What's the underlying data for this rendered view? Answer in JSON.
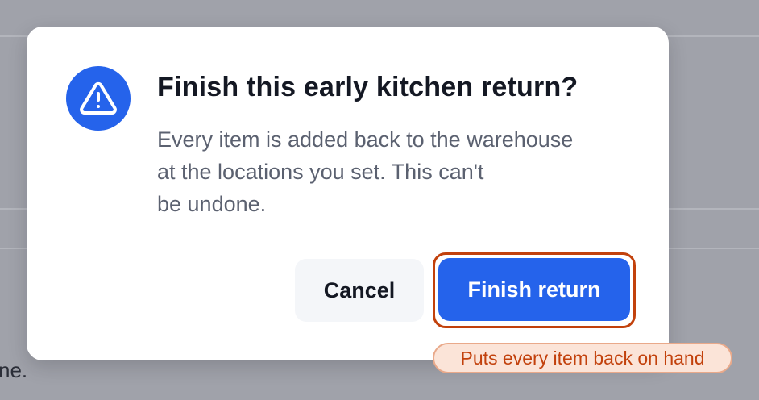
{
  "background": {
    "partial_text": "ne."
  },
  "dialog": {
    "icon": "warning-triangle-icon",
    "title": "Finish this early kitchen return?",
    "body_lines": [
      "Every item is added back to the warehouse",
      "at the locations you set. This can't",
      "be undone."
    ],
    "cancel_label": "Cancel",
    "confirm_label": "Finish return"
  },
  "hint": {
    "text": "Puts every item back on hand"
  },
  "colors": {
    "accent": "#2563eb",
    "focus_ring": "#c2410c",
    "hint_text": "#c2410c",
    "hint_bg": "#fbe4d8"
  }
}
